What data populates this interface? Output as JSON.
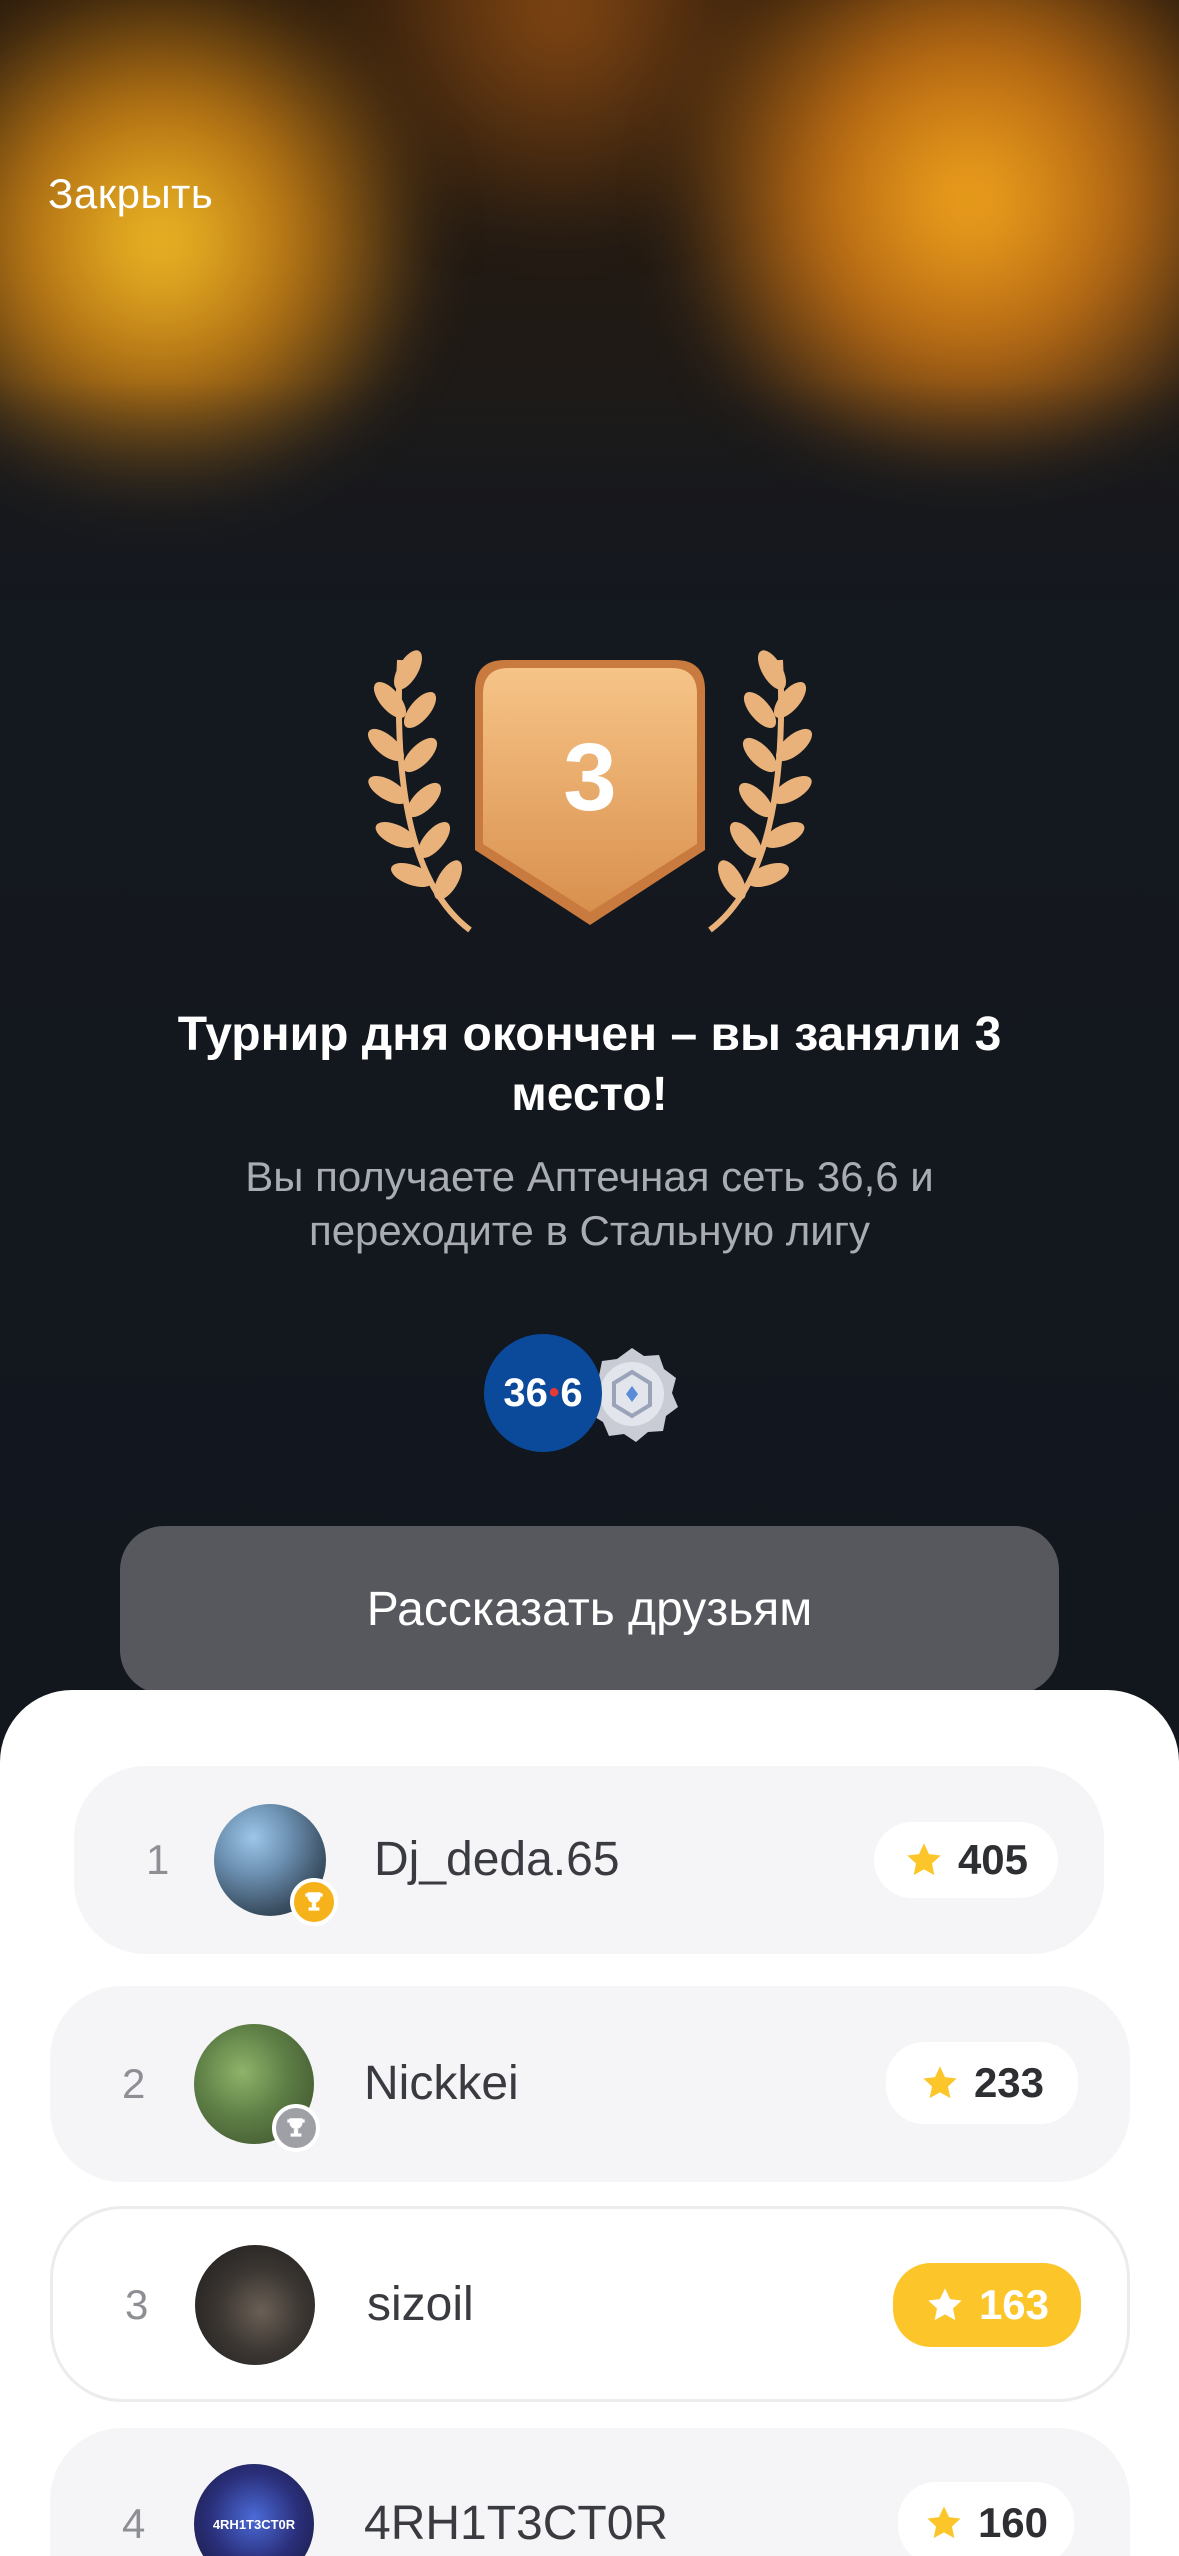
{
  "header": {
    "close_label": "Закрыть"
  },
  "result": {
    "place": "3",
    "headline": "Турнир дня окончен – вы заняли 3 место!",
    "subline": "Вы получаете Аптечная сеть 36,6 и переходите в Стальную лигу",
    "pharmacy_logo_a": "36",
    "pharmacy_logo_b": "6"
  },
  "share_button": "Рассказать друзьям",
  "leaderboard": [
    {
      "rank": "1",
      "name": "Dj_deda.65",
      "score": "405",
      "cup": "gold"
    },
    {
      "rank": "2",
      "name": "Nickkei",
      "score": "233",
      "cup": "silver"
    },
    {
      "rank": "3",
      "name": "sizoil",
      "score": "163",
      "current_user": true
    },
    {
      "rank": "4",
      "name": "4RH1T3CT0R",
      "score": "160",
      "avatar_text": "4RH1T3CT0R"
    }
  ],
  "colors": {
    "accent_gold": "#fcc62b",
    "badge_bronze": "#e2a465",
    "pharmacy_blue": "#0b4a9b"
  },
  "icons": [
    "laurel-icon",
    "star-icon",
    "trophy-icon",
    "league-steel-icon"
  ]
}
